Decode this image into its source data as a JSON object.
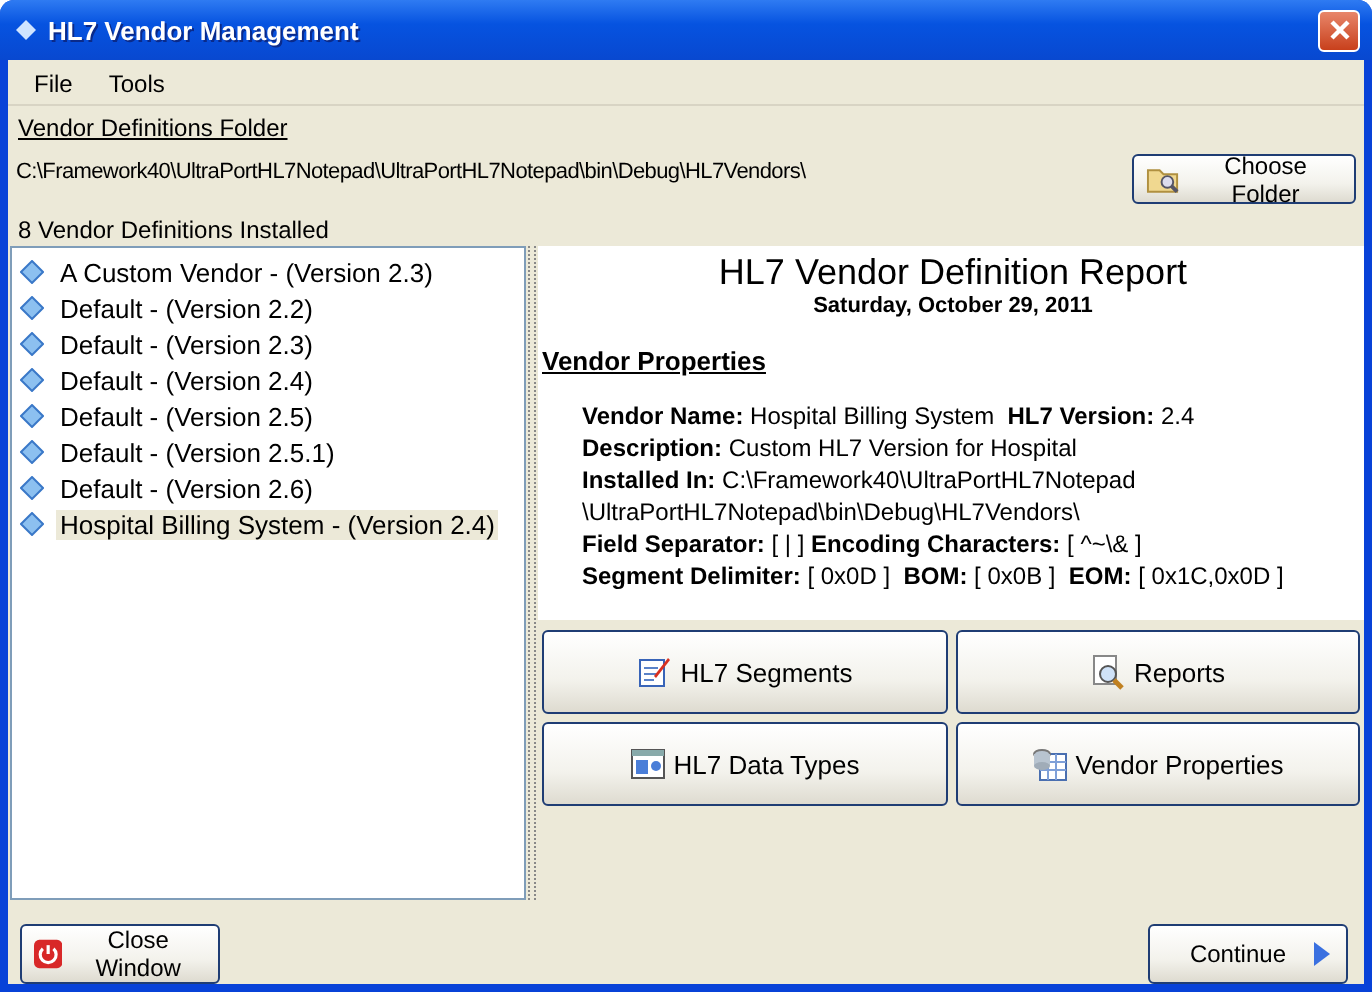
{
  "window": {
    "title": "HL7 Vendor Management"
  },
  "menu": [
    {
      "label": "File"
    },
    {
      "label": "Tools"
    }
  ],
  "folder": {
    "label": "Vendor Definitions Folder",
    "path": "C:\\Framework40\\UltraPortHL7Notepad\\UltraPortHL7Notepad\\bin\\Debug\\HL7Vendors\\",
    "button": "Choose Folder"
  },
  "vendors": {
    "count_label": "8 Vendor Definitions Installed",
    "items": [
      {
        "label": "A Custom Vendor - (Version 2.3)",
        "selected": false
      },
      {
        "label": "Default - (Version 2.2)",
        "selected": false
      },
      {
        "label": "Default - (Version 2.3)",
        "selected": false
      },
      {
        "label": "Default - (Version 2.4)",
        "selected": false
      },
      {
        "label": "Default - (Version 2.5)",
        "selected": false
      },
      {
        "label": "Default - (Version 2.5.1)",
        "selected": false
      },
      {
        "label": "Default - (Version 2.6)",
        "selected": false
      },
      {
        "label": "Hospital Billing System - (Version 2.4)",
        "selected": true
      }
    ]
  },
  "report": {
    "title": "HL7 Vendor Definition Report",
    "date": "Saturday, October 29, 2011",
    "section": "Vendor Properties",
    "lines": [
      "**Vendor Name:** Hospital Billing System  **HL7 Version:** 2.4",
      "**Description:** Custom HL7 Version for Hospital",
      "**Installed In:** C:\\Framework40\\UltraPortHL7Notepad",
      "\\UltraPortHL7Notepad\\bin\\Debug\\HL7Vendors\\",
      "**Field Separator:** [ | ] **Encoding Characters:** [ ^~\\& ]",
      "**Segment Delimiter:** [ 0x0D ]  **BOM:** [ 0x0B ]  **EOM:** [ 0x1C,0x0D ]"
    ]
  },
  "actions": [
    {
      "kind": "segments",
      "label": "HL7 Segments"
    },
    {
      "kind": "reports",
      "label": "Reports"
    },
    {
      "kind": "datatypes",
      "label": "HL7 Data Types"
    },
    {
      "kind": "properties",
      "label": "Vendor Properties"
    }
  ],
  "footer": {
    "close": "Close Window",
    "continue": "Continue"
  }
}
